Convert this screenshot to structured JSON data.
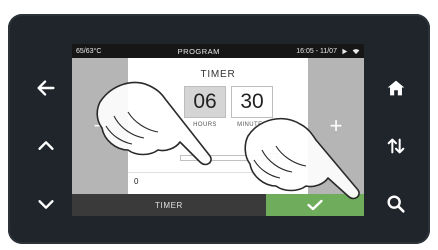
{
  "device": {
    "left_buttons": [
      {
        "icon": "arrow-left-icon"
      },
      {
        "icon": "chevron-up-icon"
      },
      {
        "icon": "chevron-down-icon"
      }
    ],
    "right_buttons": [
      {
        "icon": "home-icon"
      },
      {
        "icon": "sort-arrows-icon"
      },
      {
        "icon": "search-icon"
      }
    ]
  },
  "status": {
    "left": "65/63°C",
    "title": "PROGRAM",
    "right": "16:05 - 11/07"
  },
  "timer": {
    "title": "TIMER",
    "hours": "06",
    "minutes": "30",
    "hours_label": "HOURS",
    "minutes_label": "MINUTES",
    "minus_label": "−",
    "plus_label": "+",
    "value": "0"
  },
  "bottom": {
    "tab_label": "TIMER",
    "confirm_icon": "check-icon"
  },
  "colors": {
    "device": "#1f252b",
    "side_panel": "#b5b5b5",
    "confirm": "#6fad5c",
    "tab": "#3a3a3a"
  }
}
